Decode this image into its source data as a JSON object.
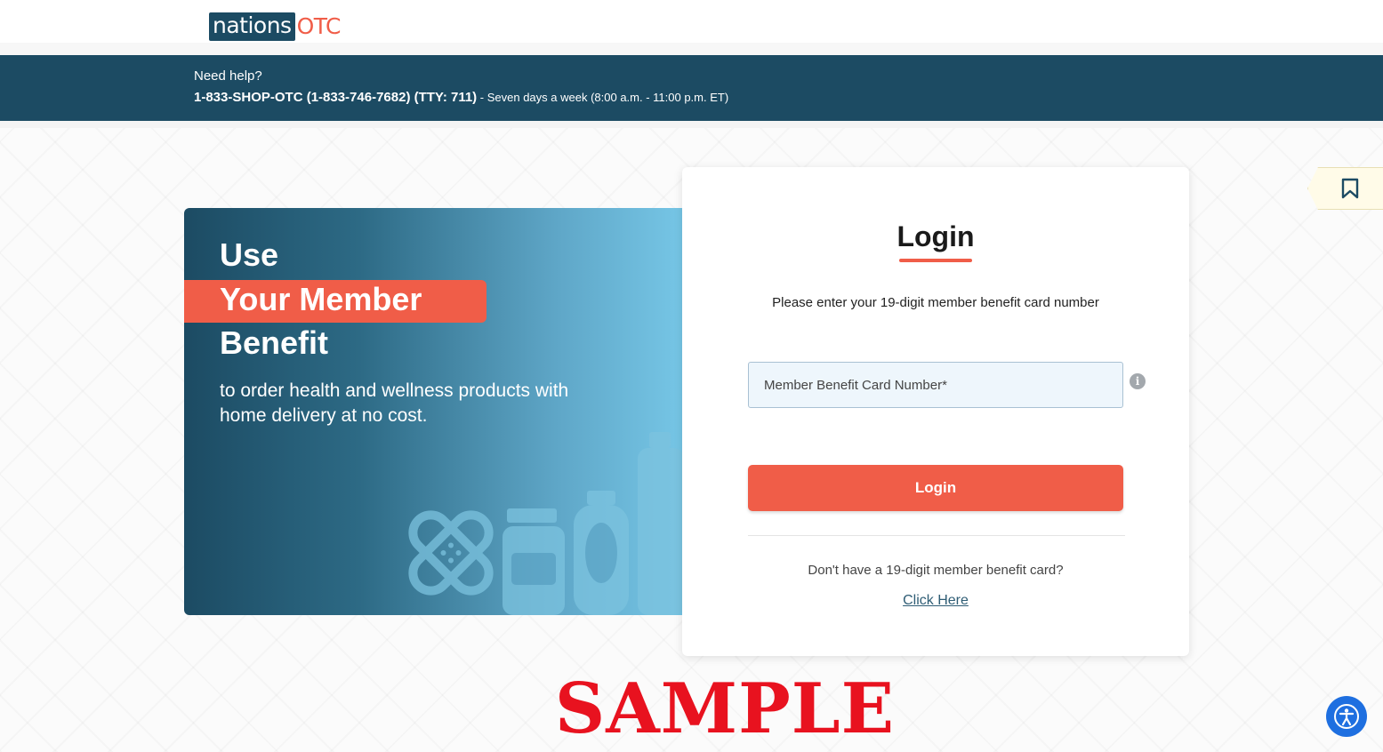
{
  "header": {
    "logo_left": "nations",
    "logo_right": "OTC"
  },
  "help": {
    "title": "Need help?",
    "phone": "1-833-SHOP-OTC (1-833-746-7682) (TTY: 711)",
    "hours": " - Seven days a week (8:00 a.m. - 11:00 p.m. ET)"
  },
  "hero": {
    "line1": "Use",
    "line2": "Your Member",
    "line3": "Benefit",
    "description": "to order health and wellness products with home delivery at no cost."
  },
  "login": {
    "title": "Login",
    "instruction": "Please enter your 19-digit member benefit card number",
    "card_placeholder": "Member Benefit Card Number*",
    "info_icon": "i",
    "button_label": "Login",
    "no_card_text": "Don't have a 19-digit member benefit card?",
    "click_here": "Click Here"
  },
  "watermark": "SAMPLE",
  "colors": {
    "brand_navy": "#1c4b63",
    "brand_coral": "#f05d48",
    "accessibility_blue": "#1e6fe0",
    "watermark_red": "#e8121f"
  },
  "icons": [
    "bookmark-icon",
    "info-icon",
    "accessibility-icon"
  ]
}
